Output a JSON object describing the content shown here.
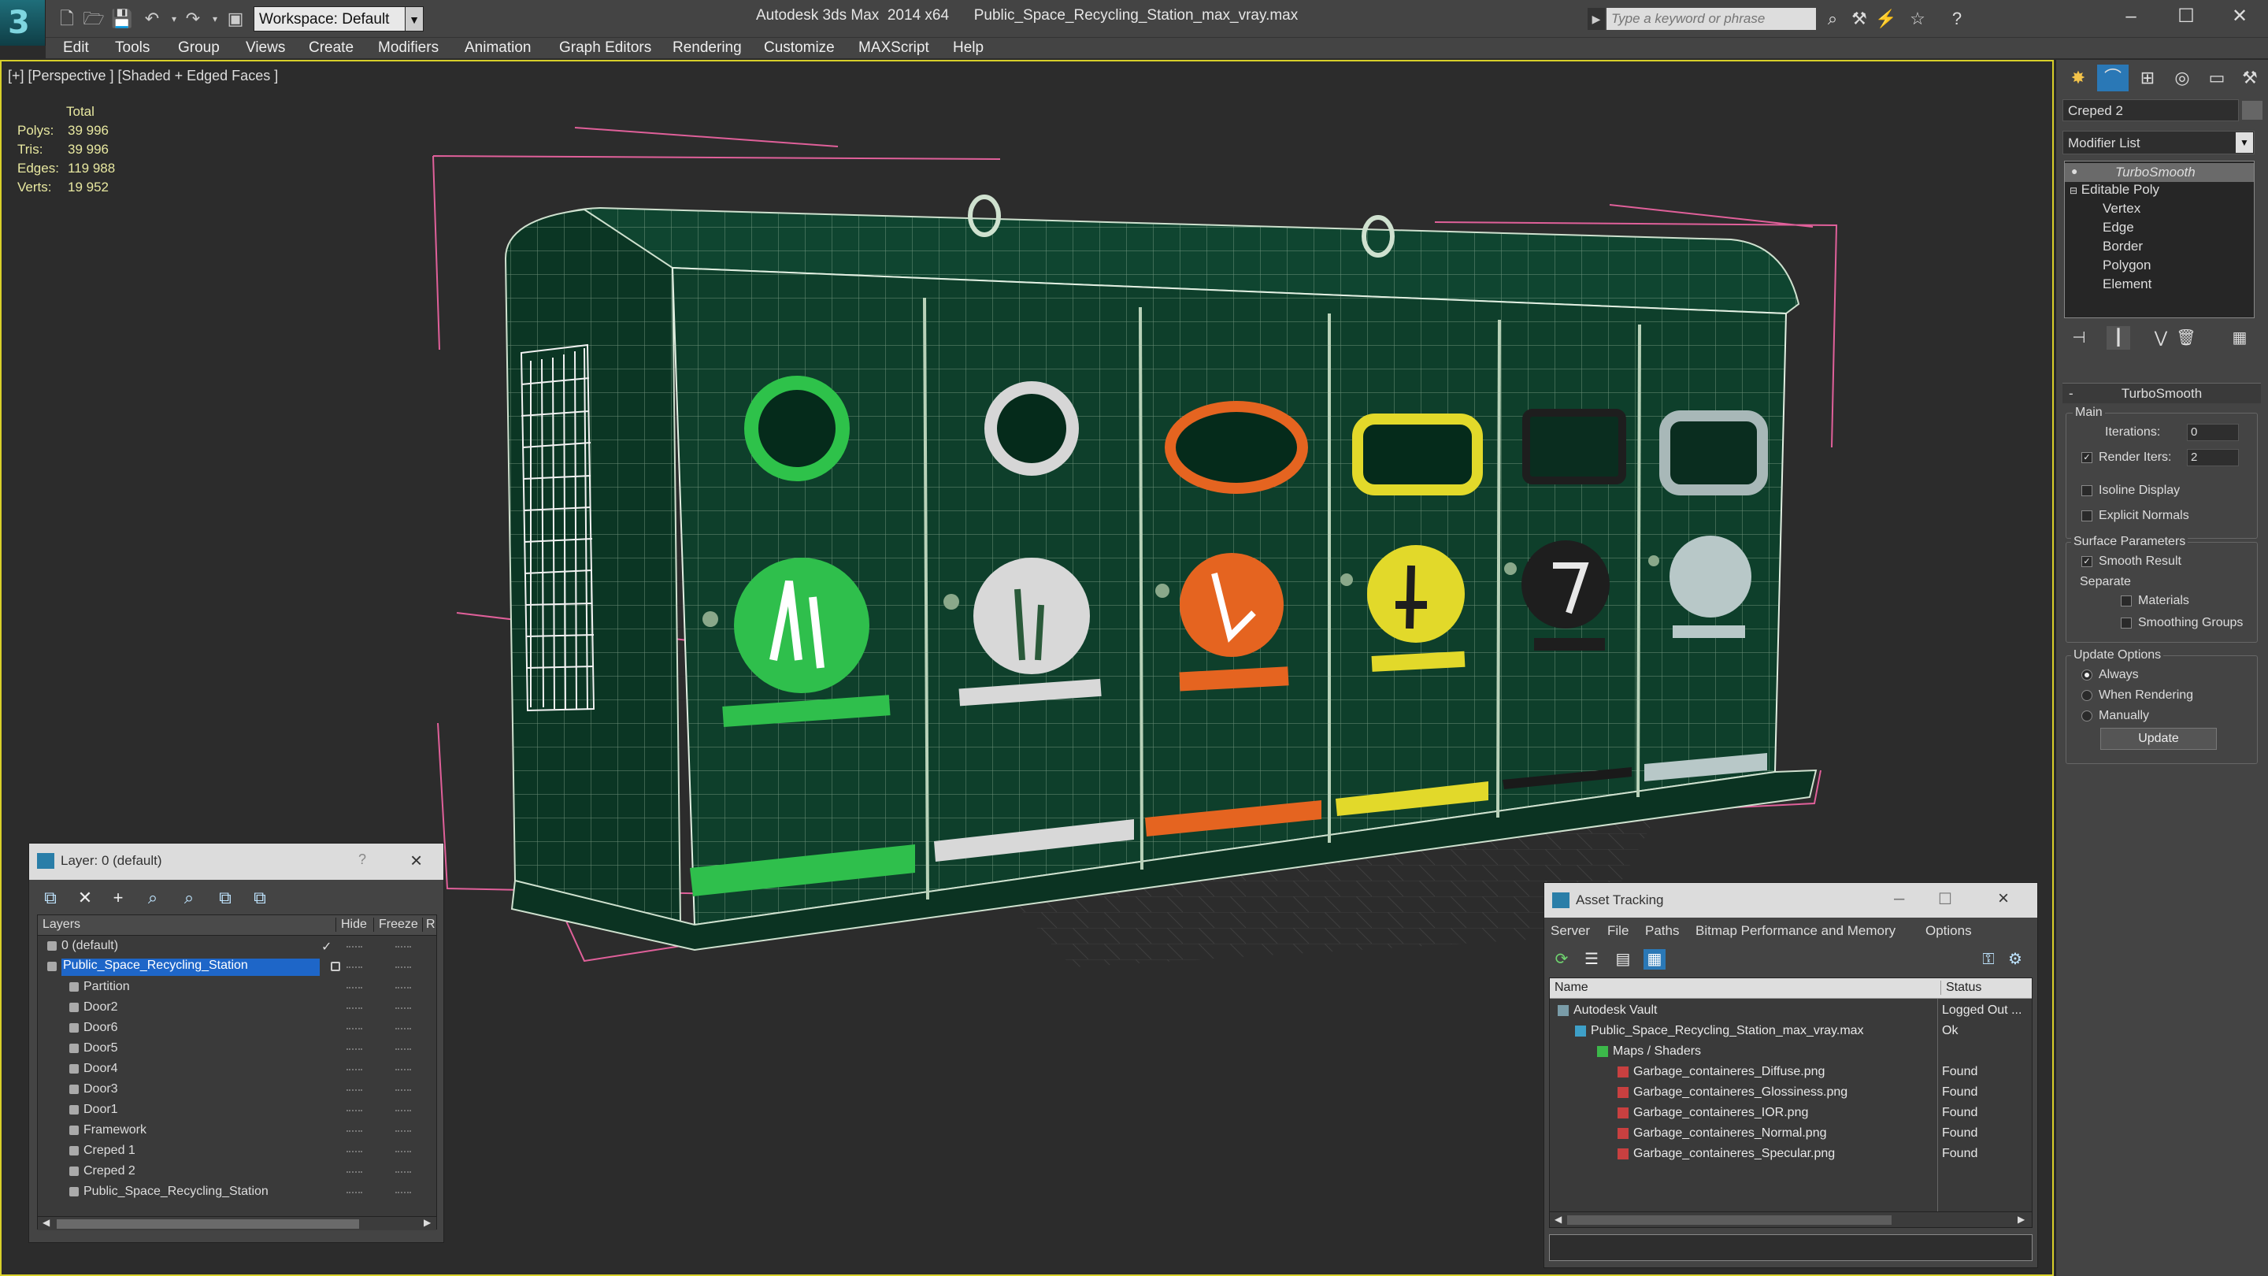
{
  "titlebar": {
    "workspace": "Workspace: Default",
    "app_title": "Autodesk 3ds Max  2014 x64      Public_Space_Recycling_Station_max_vray.max",
    "search_placeholder": "Type a keyword or phrase"
  },
  "menu": [
    "Edit",
    "Tools",
    "Group",
    "Views",
    "Create",
    "Modifiers",
    "Animation",
    "Graph Editors",
    "Rendering",
    "Customize",
    "MAXScript",
    "Help"
  ],
  "viewport": {
    "label": "[+] [Perspective ] [Shaded + Edged Faces ]",
    "stats_header": "Total",
    "stats": [
      {
        "label": "Polys:",
        "value": "39 996"
      },
      {
        "label": "Tris:",
        "value": "39 996"
      },
      {
        "label": "Edges:",
        "value": "119 988"
      },
      {
        "label": "Verts:",
        "value": "19 952"
      }
    ]
  },
  "command_panel": {
    "object_name": "Creped 2",
    "modifier_list": "Modifier List",
    "stack": [
      "TurboSmooth",
      "Editable Poly",
      "Vertex",
      "Edge",
      "Border",
      "Polygon",
      "Element"
    ],
    "rollout_title": "TurboSmooth",
    "main_group": "Main",
    "iterations_label": "Iterations:",
    "iterations_value": "0",
    "render_iters_label": "Render Iters:",
    "render_iters_value": "2",
    "isoline": "Isoline Display",
    "explicit_normals": "Explicit Normals",
    "surface_group": "Surface Parameters",
    "smooth_result": "Smooth Result",
    "separate": "Separate",
    "materials": "Materials",
    "smoothing_groups": "Smoothing Groups",
    "update_group": "Update Options",
    "always": "Always",
    "when_rendering": "When Rendering",
    "manually": "Manually",
    "update_button": "Update"
  },
  "layer_dialog": {
    "title": "Layer: 0 (default)",
    "help": "?",
    "columns": [
      "Layers",
      "Hide",
      "Freeze",
      "R"
    ],
    "rows": [
      {
        "name": "0 (default)",
        "indent": 0
      },
      {
        "name": "Public_Space_Recycling_Station",
        "indent": 1
      },
      {
        "name": "Partition",
        "indent": 2
      },
      {
        "name": "Door2",
        "indent": 2
      },
      {
        "name": "Door6",
        "indent": 2
      },
      {
        "name": "Door5",
        "indent": 2
      },
      {
        "name": "Door4",
        "indent": 2
      },
      {
        "name": "Door3",
        "indent": 2
      },
      {
        "name": "Door1",
        "indent": 2
      },
      {
        "name": "Framework",
        "indent": 2
      },
      {
        "name": "Creped 1",
        "indent": 2
      },
      {
        "name": "Creped 2",
        "indent": 2
      },
      {
        "name": "Public_Space_Recycling_Station",
        "indent": 2
      }
    ]
  },
  "asset_tracking": {
    "title": "Asset Tracking",
    "menu": [
      "Server",
      "File",
      "Paths",
      "Bitmap Performance and Memory",
      "Options"
    ],
    "columns": [
      "Name",
      "Status"
    ],
    "rows": [
      {
        "name": "Autodesk Vault",
        "status": "Logged Out ..."
      },
      {
        "name": "Public_Space_Recycling_Station_max_vray.max",
        "status": "Ok"
      },
      {
        "name": "Maps / Shaders",
        "status": ""
      },
      {
        "name": "Garbage_containeres_Diffuse.png",
        "status": "Found"
      },
      {
        "name": "Garbage_containeres_Glossiness.png",
        "status": "Found"
      },
      {
        "name": "Garbage_containeres_IOR.png",
        "status": "Found"
      },
      {
        "name": "Garbage_containeres_Normal.png",
        "status": "Found"
      },
      {
        "name": "Garbage_containeres_Specular.png",
        "status": "Found"
      }
    ]
  },
  "colors": {
    "viewport_border": "#d8d02a",
    "selection": "#1e66c8",
    "bin_green": "#0f3d2a",
    "wire": "#d6e6d6"
  }
}
